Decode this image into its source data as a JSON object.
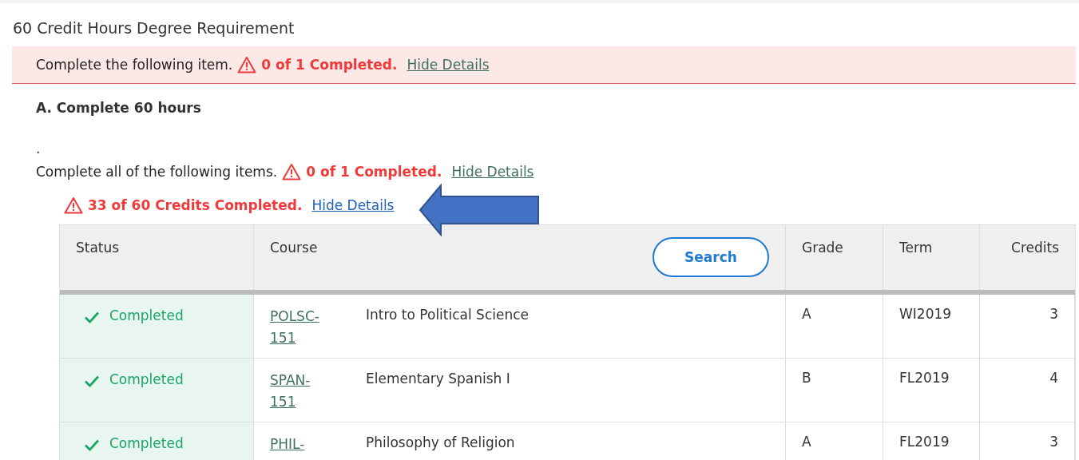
{
  "title": "60 Credit Hours Degree Requirement",
  "banner": {
    "text": "Complete the following item.",
    "progress": "0 of 1 Completed.",
    "link": "Hide Details"
  },
  "section": {
    "heading": "A. Complete 60 hours",
    "note": ".",
    "text": "Complete all of the following items.",
    "progress": "0 of 1 Completed.",
    "link": "Hide Details"
  },
  "credits": {
    "progress": "33 of 60 Credits Completed.",
    "link": "Hide Details"
  },
  "table": {
    "columns": [
      "Status",
      "Course",
      "Grade",
      "Term",
      "Credits"
    ],
    "search_button": "Search",
    "rows": [
      {
        "kind": "completed",
        "status": "Completed",
        "code": [
          "POLSC-",
          "151"
        ],
        "title": "Intro to Political Science",
        "grade": "A",
        "term": "WI2019",
        "credits": "3"
      },
      {
        "kind": "completed",
        "status": "Completed",
        "code": [
          "SPAN-",
          "151"
        ],
        "title": "Elementary Spanish I",
        "grade": "B",
        "term": "FL2019",
        "credits": "4"
      },
      {
        "kind": "completed",
        "status": "Completed",
        "code": [
          "PHIL-"
        ],
        "title": "Philosophy of Religion",
        "grade": "A",
        "term": "FL2019",
        "credits": "3"
      }
    ]
  }
}
